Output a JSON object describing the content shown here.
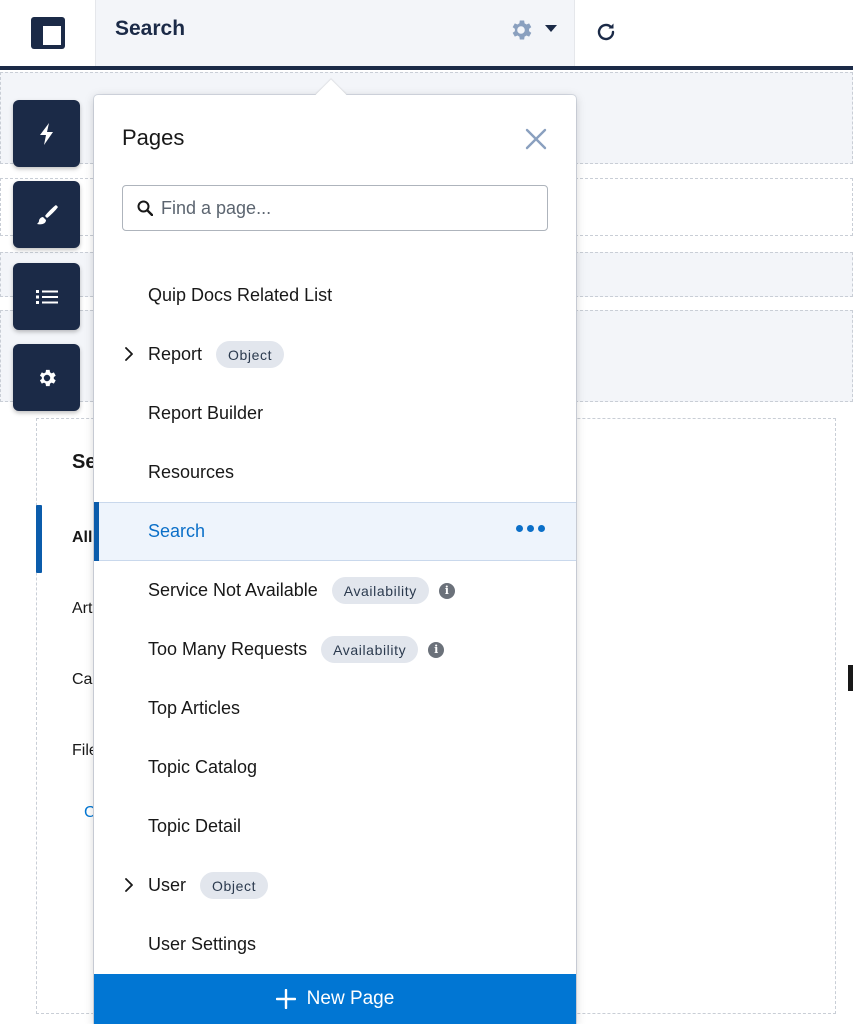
{
  "header": {
    "page_name": "Search"
  },
  "background": {
    "heading": "Se",
    "tabs": [
      "All",
      "Art",
      "Cas",
      "File"
    ],
    "link": "C"
  },
  "pages_popover": {
    "title": "Pages",
    "search": {
      "placeholder": "Find a page...",
      "value": ""
    },
    "items": [
      {
        "label": "Quip Docs Related List"
      },
      {
        "label": "Report",
        "badge": "Object",
        "expandable": true
      },
      {
        "label": "Report Builder"
      },
      {
        "label": "Resources"
      },
      {
        "label": "Search",
        "selected": true
      },
      {
        "label": "Service Not Available",
        "badge": "Availability",
        "info": true
      },
      {
        "label": "Too Many Requests",
        "badge": "Availability",
        "info": true
      },
      {
        "label": "Top Articles"
      },
      {
        "label": "Topic Catalog"
      },
      {
        "label": "Topic Detail"
      },
      {
        "label": "User",
        "badge": "Object",
        "expandable": true
      },
      {
        "label": "User Settings"
      }
    ],
    "new_page_label": "New Page"
  },
  "toolbar": {
    "buttons": [
      "lightning-icon",
      "brush-icon",
      "list-icon",
      "gear-icon"
    ]
  },
  "colors": {
    "navy": "#1b2a47",
    "brand_blue": "#0176d3",
    "selected_bg": "#eef4fc"
  }
}
